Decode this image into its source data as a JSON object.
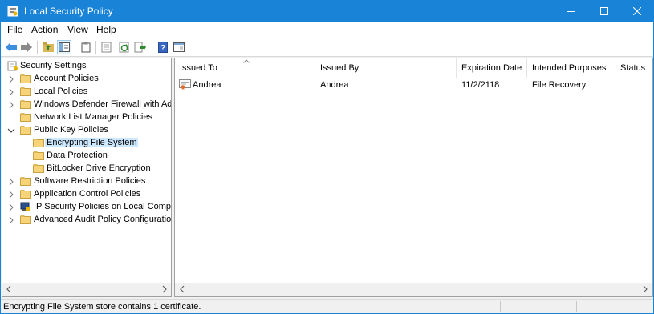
{
  "window": {
    "title": "Local Security Policy"
  },
  "menu": [
    {
      "label": "File",
      "mnemonic": "F",
      "rest": "ile"
    },
    {
      "label": "Action",
      "mnemonic": "A",
      "rest": "ction"
    },
    {
      "label": "View",
      "mnemonic": "V",
      "rest": "iew"
    },
    {
      "label": "Help",
      "mnemonic": "H",
      "rest": "elp"
    }
  ],
  "toolbar": {
    "icons": [
      "back-icon",
      "forward-icon",
      "up-folder-icon",
      "show-hide-tree-icon",
      "clipboard-icon",
      "export-list-icon",
      "refresh-icon",
      "export-icon",
      "help-icon",
      "properties-icon"
    ]
  },
  "tree": {
    "root": "Security Settings",
    "items": [
      {
        "label": "Account Policies"
      },
      {
        "label": "Local Policies"
      },
      {
        "label": "Windows Defender Firewall with Adva"
      },
      {
        "label": "Network List Manager Policies"
      },
      {
        "label": "Public Key Policies"
      },
      {
        "label": "Encrypting File System"
      },
      {
        "label": "Data Protection"
      },
      {
        "label": "BitLocker Drive Encryption"
      },
      {
        "label": "Software Restriction Policies"
      },
      {
        "label": "Application Control Policies"
      },
      {
        "label": "IP Security Policies on Local Compute"
      },
      {
        "label": "Advanced Audit Policy Configuration"
      }
    ]
  },
  "list": {
    "columns": [
      "Issued To",
      "Issued By",
      "Expiration Date",
      "Intended Purposes",
      "Status"
    ],
    "rows": [
      {
        "issued_to": "Andrea",
        "issued_by": "Andrea",
        "expiration": "11/2/2118",
        "purposes": "File Recovery",
        "status": ""
      }
    ]
  },
  "status": {
    "text": "Encrypting File System store contains 1 certificate."
  },
  "colors": {
    "titlebar": "#1883d7",
    "selection": "#cce8ff",
    "folder": "#dcb85a"
  }
}
